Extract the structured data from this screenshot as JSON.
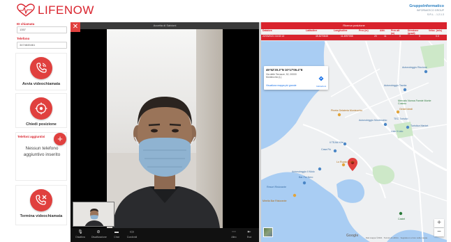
{
  "app": {
    "logo_text": "LIFENOW",
    "brand_color": "#d9232d",
    "partner_name": "GruppoInformatico",
    "partner_sub_1": "INFORMATICO GROUP",
    "partner_sub_2": "S.R.L. - 1.2.1.3"
  },
  "sidebar": {
    "id_label": "ID chiamata",
    "id_value": "1357",
    "phone_label": "Telefono",
    "phone_value": "3474845461",
    "video_call_label": "Avvia videochiamata",
    "position_label": "Chiedi posizione",
    "extra_phones_label": "Telefoni aggiuntivi",
    "add_symbol": "+",
    "no_phone_text": "Nessun telefono aggiuntivo inserito",
    "end_call_label": "Termina videochiamata"
  },
  "video": {
    "title": "Accetta di Salvioni",
    "close_symbol": "✕",
    "controls": [
      {
        "name": "mic",
        "icon": "microphone-icon",
        "label": "Disattiva"
      },
      {
        "name": "cam",
        "icon": "camera-off-icon",
        "label": "Disattivazione"
      },
      {
        "name": "chat",
        "icon": "chat-icon",
        "label": "Chat"
      },
      {
        "name": "share",
        "icon": "screen-share-icon",
        "label": "Condividi"
      },
      {
        "name": "more",
        "icon": "more-icon",
        "label": "Altro"
      },
      {
        "name": "leave",
        "icon": "leave-icon",
        "label": "Esci"
      }
    ]
  },
  "map": {
    "title": "Ricerca posizione",
    "columns": [
      "Data/ora",
      "Latitudine",
      "Longitudine",
      "Prec (m)",
      "Altit.",
      "Prec alt (m)",
      "Direzione (gradi)",
      "Veloc. (m/s)"
    ],
    "row": [
      "22/03/2021 16:02:13",
      "45.8270845",
      "11.4997058",
      "20",
      "11",
      "0",
      "0",
      "0.0"
    ],
    "popup_coords": "45°52'30.3\"N 10°17'06.4\"E",
    "popup_address": "Via delle Terrazze, 52, 00000 Montecchio (L)",
    "popup_link": "Visualizza mappa più grande",
    "popup_directions": "Indicazioni",
    "pois": [
      {
        "name": "Autonoleggio Riccione",
        "kind": "blue"
      },
      {
        "name": "Autonoleggio Tavola",
        "kind": "blue"
      },
      {
        "name": "Pineta Gelateria Montecchio",
        "kind": "orange"
      },
      {
        "name": "Autonoleggio Montecchio",
        "kind": "blue"
      },
      {
        "name": "Gelati Ideali",
        "kind": "orange"
      },
      {
        "name": "TEC Turistici",
        "kind": "blue"
      },
      {
        "name": "Mercato Nonna Fannie Monte Cosimo",
        "kind": "green"
      },
      {
        "name": "Turistica Market",
        "kind": "blue"
      },
      {
        "name": "Lido Il Lido",
        "kind": "blue"
      },
      {
        "name": "Il TEAM Kite",
        "kind": "blue"
      },
      {
        "name": "Casa Rù",
        "kind": "blue"
      },
      {
        "name": "Lo Ruota Ladies",
        "kind": "orange"
      },
      {
        "name": "Autonoleggio Il Molo",
        "kind": "blue"
      },
      {
        "name": "Bar Fai Nero",
        "kind": "blue"
      },
      {
        "name": "Resort Ristorante",
        "kind": "blue"
      },
      {
        "name": "Mirella Bar Ristorante",
        "kind": "orange"
      },
      {
        "name": "Castel",
        "kind": "green"
      }
    ],
    "zoom_in": "+",
    "zoom_out": "−",
    "google_text": "Google",
    "attribution": "Dati mappa ©2021 · Termini di utilizzo · Segnala un errore nella mappa",
    "marker_color": "#e0403e",
    "water_color": "#a9cdf3"
  }
}
